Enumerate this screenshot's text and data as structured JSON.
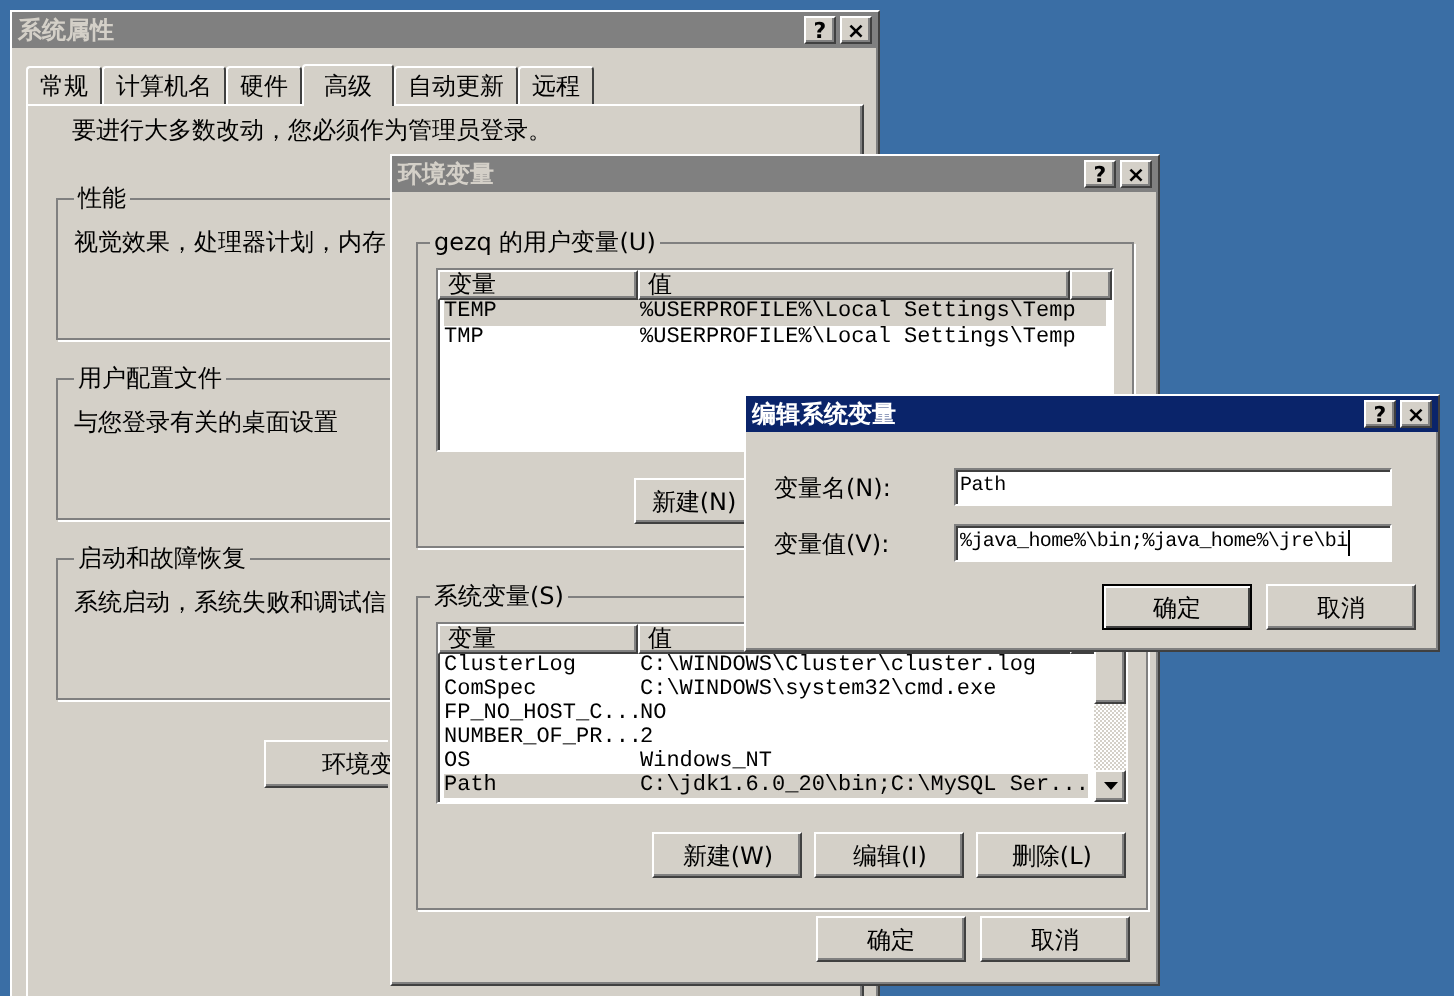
{
  "system_properties": {
    "title": "系统属性",
    "active": false,
    "title_buttons": [
      "?",
      "×"
    ],
    "tabs": [
      {
        "label": "常规",
        "selected": false
      },
      {
        "label": "计算机名",
        "selected": false
      },
      {
        "label": "硬件",
        "selected": false
      },
      {
        "label": "高级",
        "selected": true
      },
      {
        "label": "自动更新",
        "selected": false
      },
      {
        "label": "远程",
        "selected": false
      }
    ],
    "notice": "要进行大多数改动，您必须作为管理员登录。",
    "groups": [
      {
        "label": "性能",
        "text": "视觉效果，处理器计划，内存"
      },
      {
        "label": "用户配置文件",
        "text": "与您登录有关的桌面设置"
      },
      {
        "label": "启动和故障恢复",
        "text": "系统启动，系统失败和调试信"
      }
    ],
    "env_button": "环境变"
  },
  "environment_variables": {
    "title": "环境变量",
    "active": false,
    "title_buttons": [
      "?",
      "×"
    ],
    "user_group": {
      "label": "gezq 的用户变量(U)",
      "columns": [
        "变量",
        "值"
      ],
      "rows": [
        {
          "name": "TEMP",
          "value": "%USERPROFILE%\\Local Settings\\Temp",
          "selected": true
        },
        {
          "name": "TMP",
          "value": "%USERPROFILE%\\Local Settings\\Temp",
          "selected": false
        }
      ],
      "buttons": [
        "新建(N)"
      ]
    },
    "system_group": {
      "label": "系统变量(S)",
      "columns": [
        "变量",
        "值"
      ],
      "rows": [
        {
          "name": "ClusterLog",
          "value": "C:\\WINDOWS\\Cluster\\cluster.log",
          "selected": false
        },
        {
          "name": "ComSpec",
          "value": "C:\\WINDOWS\\system32\\cmd.exe",
          "selected": false
        },
        {
          "name": "FP_NO_HOST_C...",
          "value": "NO",
          "selected": false
        },
        {
          "name": "NUMBER_OF_PR...",
          "value": "2",
          "selected": false
        },
        {
          "name": "OS",
          "value": "Windows_NT",
          "selected": false
        },
        {
          "name": "Path",
          "value": "C:\\jdk1.6.0_20\\bin;C:\\MySQL Ser...",
          "selected": true
        }
      ],
      "buttons": [
        "新建(W)",
        "编辑(I)",
        "删除(L)"
      ]
    },
    "buttons": [
      "确定",
      "取消"
    ]
  },
  "edit_dialog": {
    "title": "编辑系统变量",
    "active": true,
    "title_buttons": [
      "?",
      "×"
    ],
    "fields": [
      {
        "label": "变量名(N):",
        "value": "Path"
      },
      {
        "label": "变量值(V):",
        "value": "%java_home%\\bin;%java_home%\\jre\\bi"
      }
    ],
    "buttons": [
      {
        "label": "确定",
        "default": true
      },
      {
        "label": "取消",
        "default": false
      }
    ]
  }
}
